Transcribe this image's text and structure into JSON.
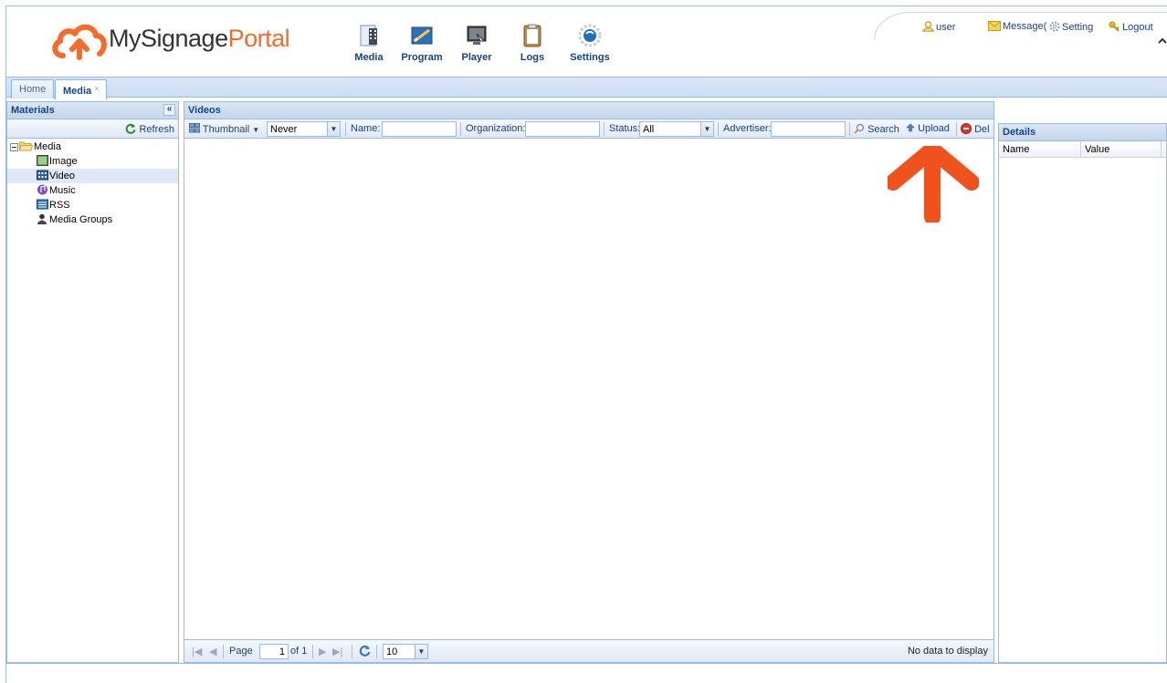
{
  "brand": {
    "name_part1": "MySignage",
    "name_part2": "Portal"
  },
  "nav": [
    {
      "label": "Media",
      "icon": "media-icon"
    },
    {
      "label": "Program",
      "icon": "program-icon"
    },
    {
      "label": "Player",
      "icon": "player-icon"
    },
    {
      "label": "Logs",
      "icon": "logs-icon"
    },
    {
      "label": "Settings",
      "icon": "settings-icon"
    }
  ],
  "userbar": {
    "user": "user",
    "message": "Message(",
    "setting": "Setting",
    "logout": "Logout"
  },
  "tabs": [
    {
      "label": "Home"
    },
    {
      "label": "Media",
      "close": "×"
    }
  ],
  "materials": {
    "title": "Materials",
    "collapse": "«",
    "refresh": "Refresh",
    "tree": [
      "Media",
      "Image",
      "Video",
      "Music",
      "RSS",
      "Media Groups"
    ]
  },
  "videos": {
    "title": "Videos",
    "toolbar": {
      "view": "Thumbnail",
      "period": "Never",
      "name_label": "Name:",
      "org_label": "Organization:",
      "status_label": "Status:",
      "status_value": "All",
      "advertiser_label": "Advertiser:",
      "search": "Search",
      "upload": "Upload",
      "delete": "Del"
    },
    "paging": {
      "page_label": "Page",
      "page_value": "1",
      "of": "of 1",
      "page_size": "10",
      "status": "No data to display"
    }
  },
  "details": {
    "title": "Details",
    "col_name": "Name",
    "col_value": "Value"
  },
  "colors": {
    "accent_orange": "#f0521e",
    "panel_border": "#99bbe8",
    "header_text": "#15428b"
  }
}
